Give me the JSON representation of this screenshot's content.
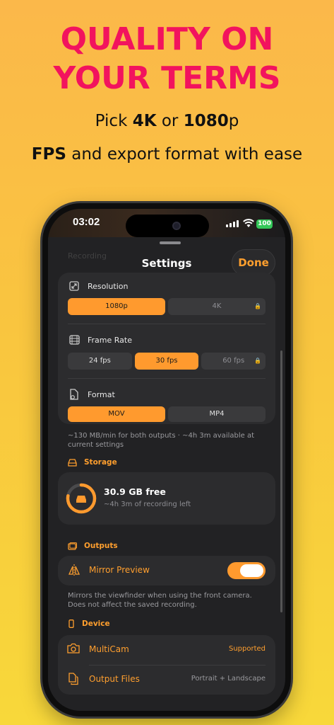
{
  "promo": {
    "headline_line1": "QUALITY ON",
    "headline_line2": "YOUR TERMS",
    "sub1_pre": "Pick ",
    "sub1_bold1": "4K",
    "sub1_mid": " or ",
    "sub1_bold2": "1080",
    "sub1_post": "p",
    "sub2_bold": "FPS",
    "sub2_rest": " and export format with ease",
    "headline_color": "#f2135e"
  },
  "status_bar": {
    "time": "03:02",
    "battery": "100"
  },
  "sheet": {
    "behind_title": "Recording",
    "title": "Settings",
    "done_label": "Done",
    "accent": "#ff9a2e"
  },
  "video": {
    "resolution": {
      "label": "Resolution",
      "icon": "expand-icon",
      "options": [
        {
          "label": "1080p",
          "selected": true,
          "locked": false
        },
        {
          "label": "4K",
          "selected": false,
          "locked": true
        }
      ]
    },
    "frame_rate": {
      "label": "Frame Rate",
      "icon": "film-icon",
      "options": [
        {
          "label": "24 fps",
          "selected": false,
          "locked": false
        },
        {
          "label": "30 fps",
          "selected": true,
          "locked": false
        },
        {
          "label": "60 fps",
          "selected": false,
          "locked": true
        }
      ]
    },
    "format": {
      "label": "Format",
      "icon": "file-gear-icon",
      "options": [
        {
          "label": "MOV",
          "selected": true,
          "locked": false
        },
        {
          "label": "MP4",
          "selected": false,
          "locked": false
        }
      ]
    },
    "note": "~130 MB/min for both outputs · ~4h 3m available at current settings"
  },
  "storage": {
    "section_label": "Storage",
    "free": "30.9 GB free",
    "remaining": "~4h 3m of recording left",
    "used_fraction": 0.78
  },
  "outputs": {
    "section_label": "Outputs",
    "mirror_label": "Mirror Preview",
    "mirror_on": true,
    "mirror_note": "Mirrors the viewfinder when using the front camera. Does not affect the saved recording."
  },
  "device": {
    "section_label": "Device",
    "rows": [
      {
        "label": "MultiCam",
        "value": "Supported",
        "icon": "camera-icon",
        "value_color": "#ff9f2e"
      },
      {
        "label": "Output Files",
        "value": "Portrait + Landscape",
        "icon": "files-icon",
        "value_color": "#9a9a9e"
      }
    ]
  }
}
